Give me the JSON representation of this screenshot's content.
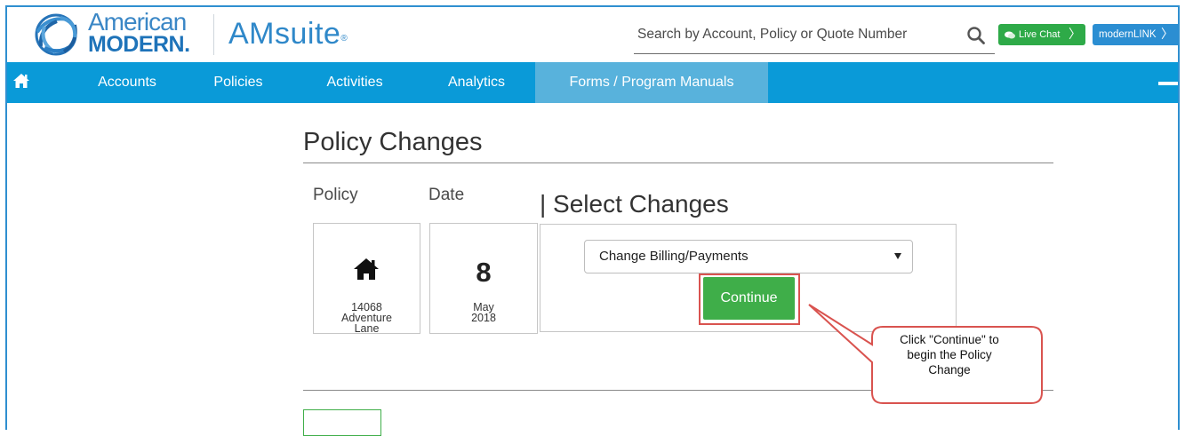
{
  "header": {
    "logo_line1": "American",
    "logo_line2": "MODERN.",
    "app_name": "AMsuite",
    "app_mark": "®",
    "search_placeholder": "Search by Account, Policy or Quote Number",
    "live_chat_label": "Live Chat",
    "modernlink_label": "modernLINK",
    "chevron": "〉"
  },
  "nav": {
    "items": [
      {
        "label": "Accounts"
      },
      {
        "label": "Policies"
      },
      {
        "label": "Activities"
      },
      {
        "label": "Analytics"
      },
      {
        "label": "Forms / Program Manuals"
      }
    ],
    "active_index": 4
  },
  "main": {
    "title": "Policy Changes",
    "policy_label": "Policy",
    "date_label": "Date",
    "select_heading": "| Select Changes",
    "policy_card": {
      "address_line1": "14068",
      "address_line2": "Adventure",
      "address_line3": "Lane"
    },
    "date_card": {
      "day": "8",
      "month": "May",
      "year": "2018"
    },
    "change_select_value": "Change Billing/Payments",
    "continue_label": "Continue"
  },
  "callout": {
    "line1": "Click \"Continue\" to",
    "line2": "begin the Policy",
    "line3": "Change"
  },
  "colors": {
    "nav_bg": "#0a9ad8",
    "nav_active": "#58b2dc",
    "brand_blue": "#2f88c9",
    "live_chat_green": "#2eaa48",
    "continue_green": "#3fae49",
    "highlight_red": "#d9534f"
  },
  "icons": [
    "logo-swirl-icon",
    "search-icon",
    "chat-bubble-icon",
    "home-icon",
    "dropdown-arrow-icon"
  ]
}
